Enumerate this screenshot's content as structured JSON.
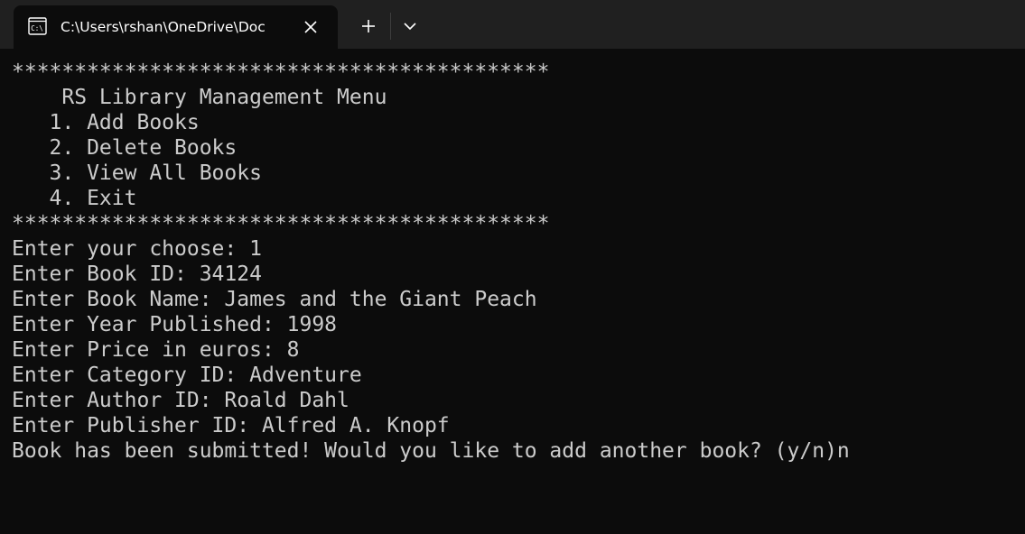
{
  "tab": {
    "icon": "command-prompt-icon",
    "title": "C:\\Users\\rshan\\OneDrive\\Doc"
  },
  "titlebar": {
    "new_tab_icon": "plus-icon",
    "dropdown_icon": "chevron-down-icon"
  },
  "terminal": {
    "lines": [
      "*******************************************",
      "    RS Library Management Menu",
      "   1. Add Books",
      "   2. Delete Books",
      "   3. View All Books",
      "   4. Exit",
      "*******************************************",
      "Enter your choose: 1",
      "Enter Book ID: 34124",
      "Enter Book Name: James and the Giant Peach",
      "Enter Year Published: 1998",
      "Enter Price in euros: 8",
      "Enter Category ID: Adventure",
      "Enter Author ID: Roald Dahl",
      "Enter Publisher ID: Alfred A. Knopf",
      "Book has been submitted! Would you like to add another book? (y/n)n"
    ]
  },
  "colors": {
    "background": "#0c0c0c",
    "titlebar": "#202020",
    "text": "#cccccc"
  }
}
